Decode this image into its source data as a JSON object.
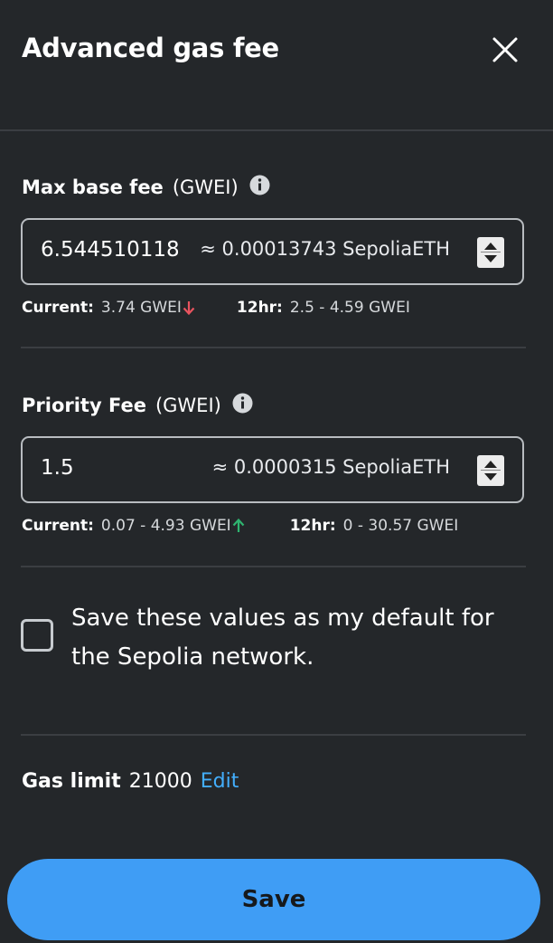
{
  "header": {
    "title": "Advanced gas fee",
    "close_icon": "close-icon"
  },
  "max_base_fee": {
    "label": "Max base fee",
    "unit": "(GWEI)",
    "value": "6.544510118",
    "conversion": "≈ 0.00013743 SepoliaETH",
    "current_label": "Current:",
    "current_value": "3.74 GWEI",
    "current_trend": "down",
    "range_label": "12hr:",
    "range_value": "2.5 - 4.59 GWEI"
  },
  "priority_fee": {
    "label": "Priority Fee",
    "unit": "(GWEI)",
    "value": "1.5",
    "conversion": "≈ 0.0000315 SepoliaETH",
    "current_label": "Current:",
    "current_value": "0.07 - 4.93 GWEI",
    "current_trend": "up",
    "range_label": "12hr:",
    "range_value": "0 - 30.57 GWEI"
  },
  "save_default": {
    "checked": false,
    "label": "Save these values as my default for the Sepolia network."
  },
  "gas_limit": {
    "label": "Gas limit",
    "value": "21000",
    "edit_label": "Edit"
  },
  "footer": {
    "save_label": "Save"
  },
  "colors": {
    "background": "#24272a",
    "accent": "#3f9df5",
    "link": "#43aefc",
    "trend_down": "#e9545f",
    "trend_up": "#2fb470"
  }
}
